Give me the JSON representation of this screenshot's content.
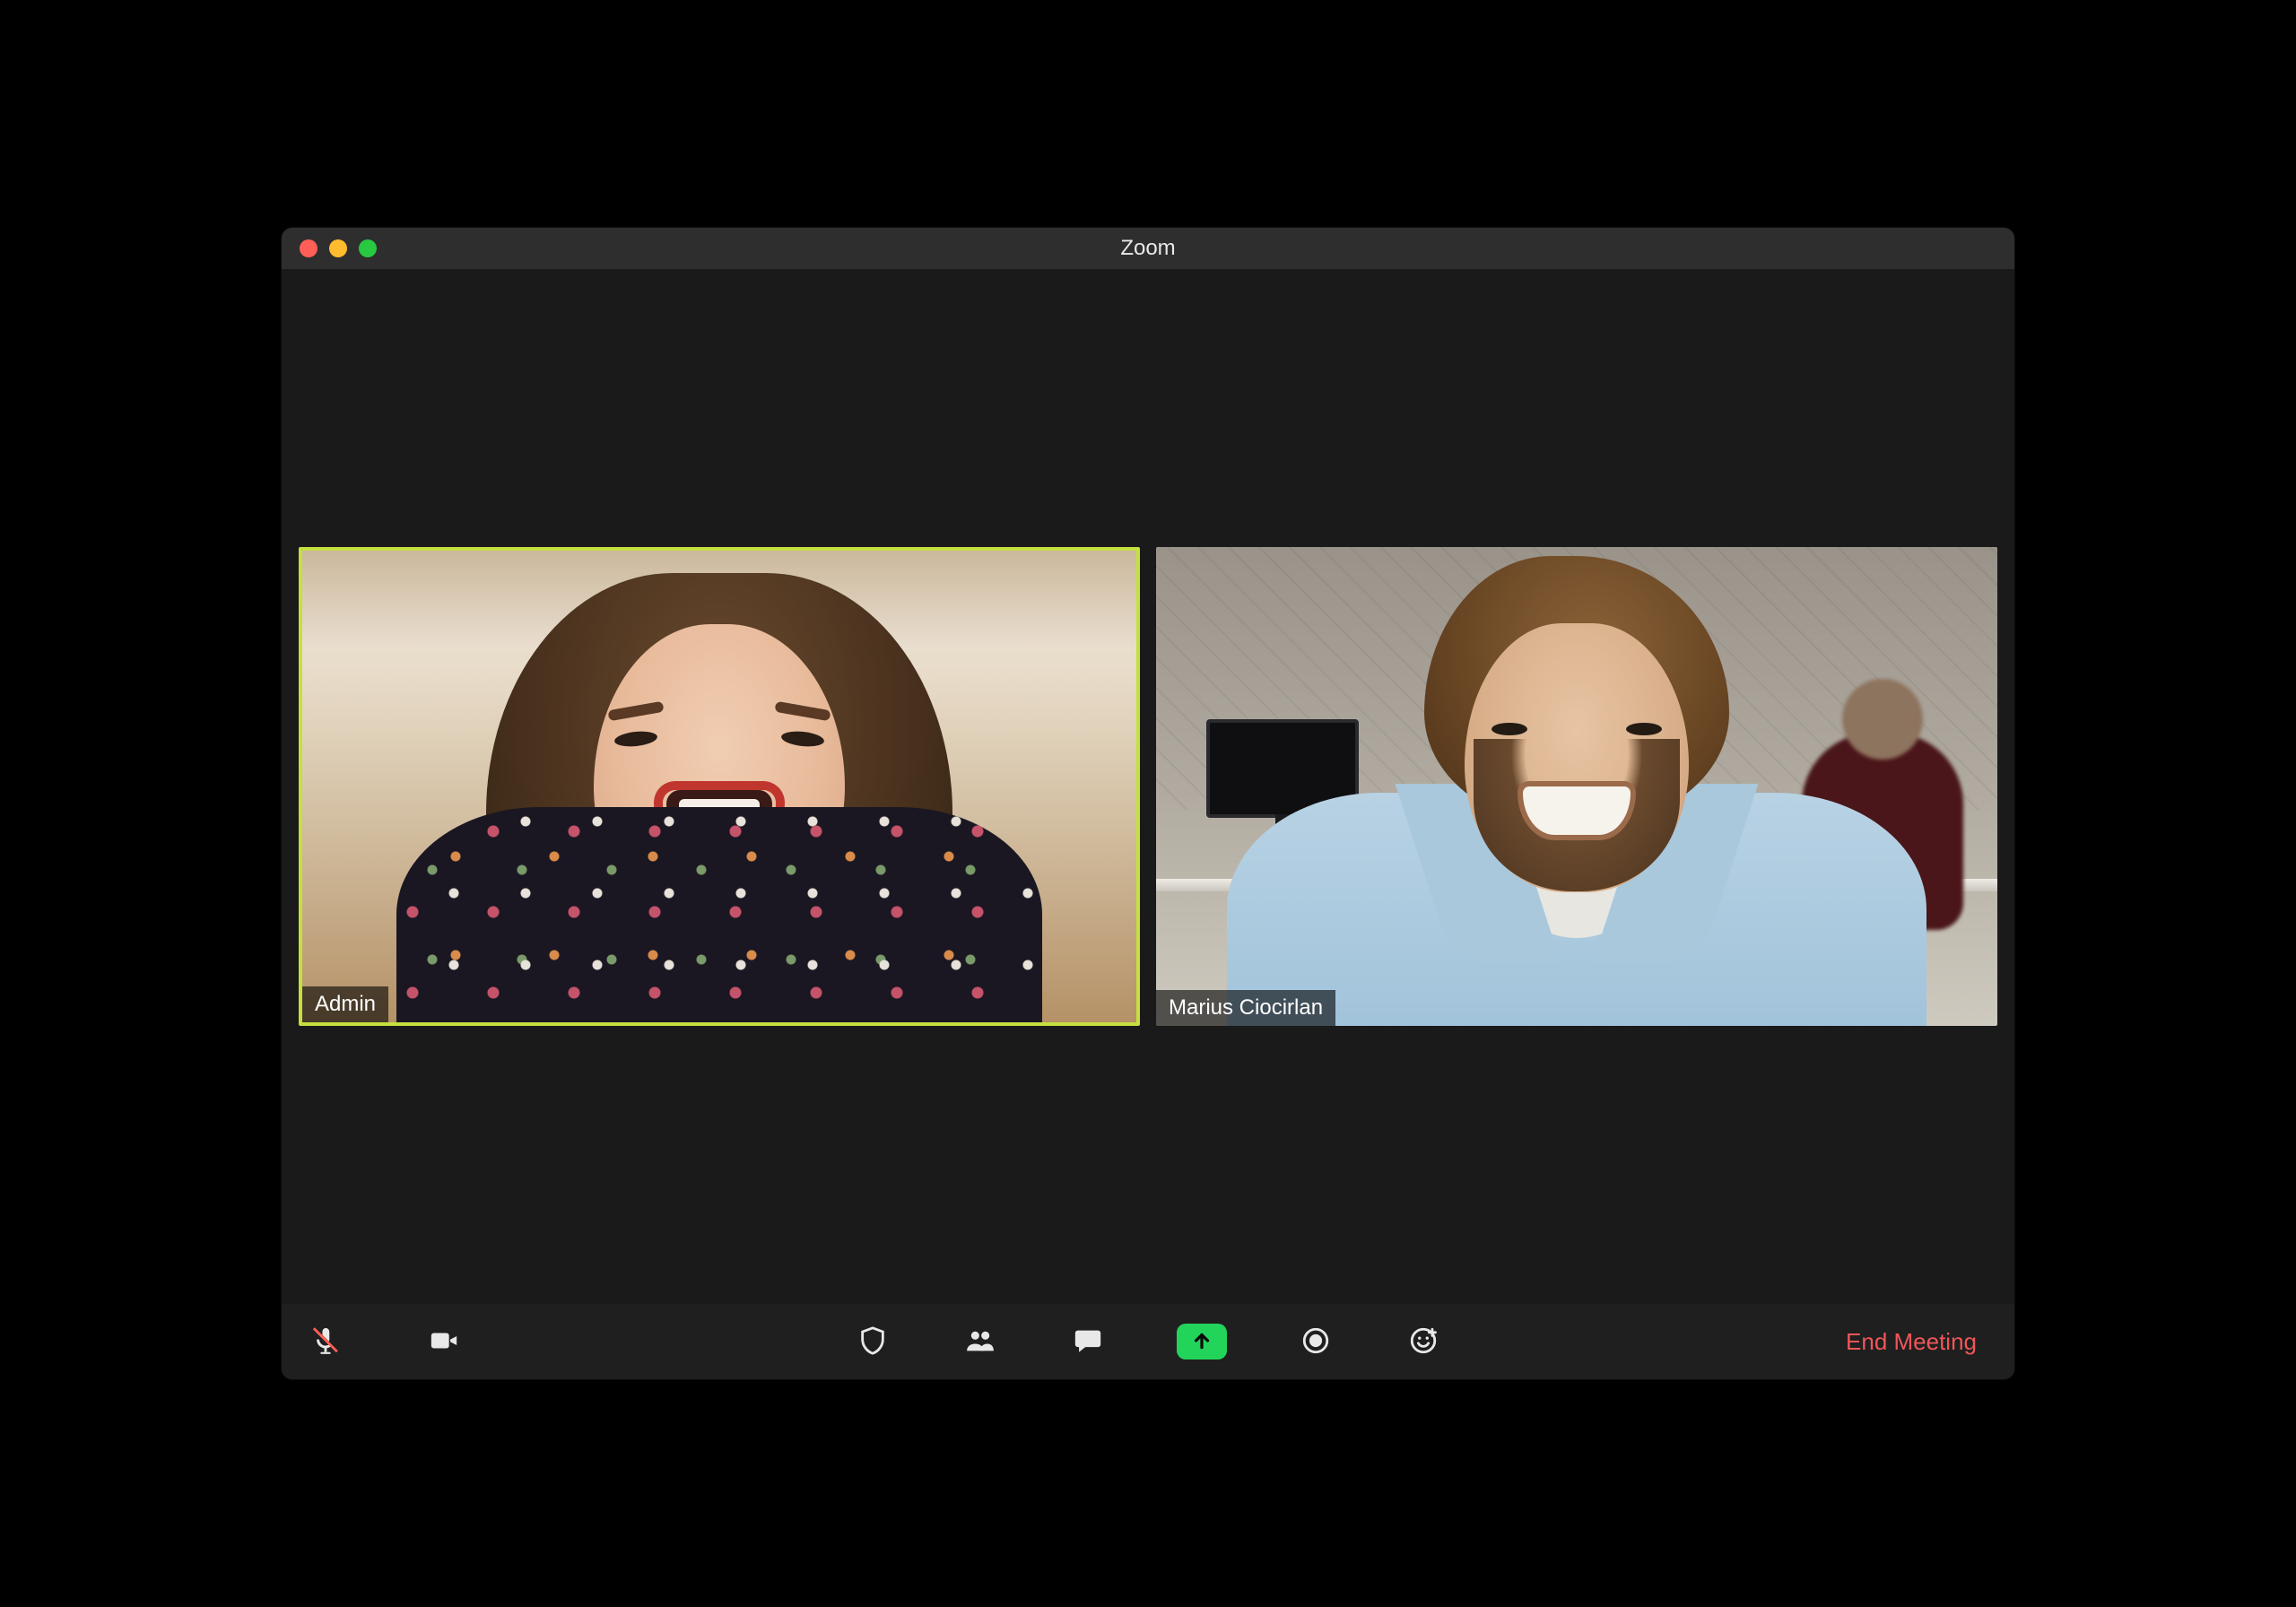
{
  "window": {
    "title": "Zoom"
  },
  "participants": [
    {
      "name": "Admin",
      "speaking": true
    },
    {
      "name": "Marius Ciocirlan",
      "speaking": false
    }
  ],
  "toolbar": {
    "mute_icon": "microphone-muted-icon",
    "video_icon": "video-camera-icon",
    "security_icon": "shield-icon",
    "participants_icon": "people-icon",
    "chat_icon": "chat-bubble-icon",
    "share_icon": "share-screen-icon",
    "record_icon": "record-icon",
    "reactions_icon": "reactions-icon",
    "end_label": "End Meeting"
  },
  "colors": {
    "speaking_border": "#c5e03e",
    "share_button": "#23d45b",
    "end_meeting": "#f05659"
  }
}
